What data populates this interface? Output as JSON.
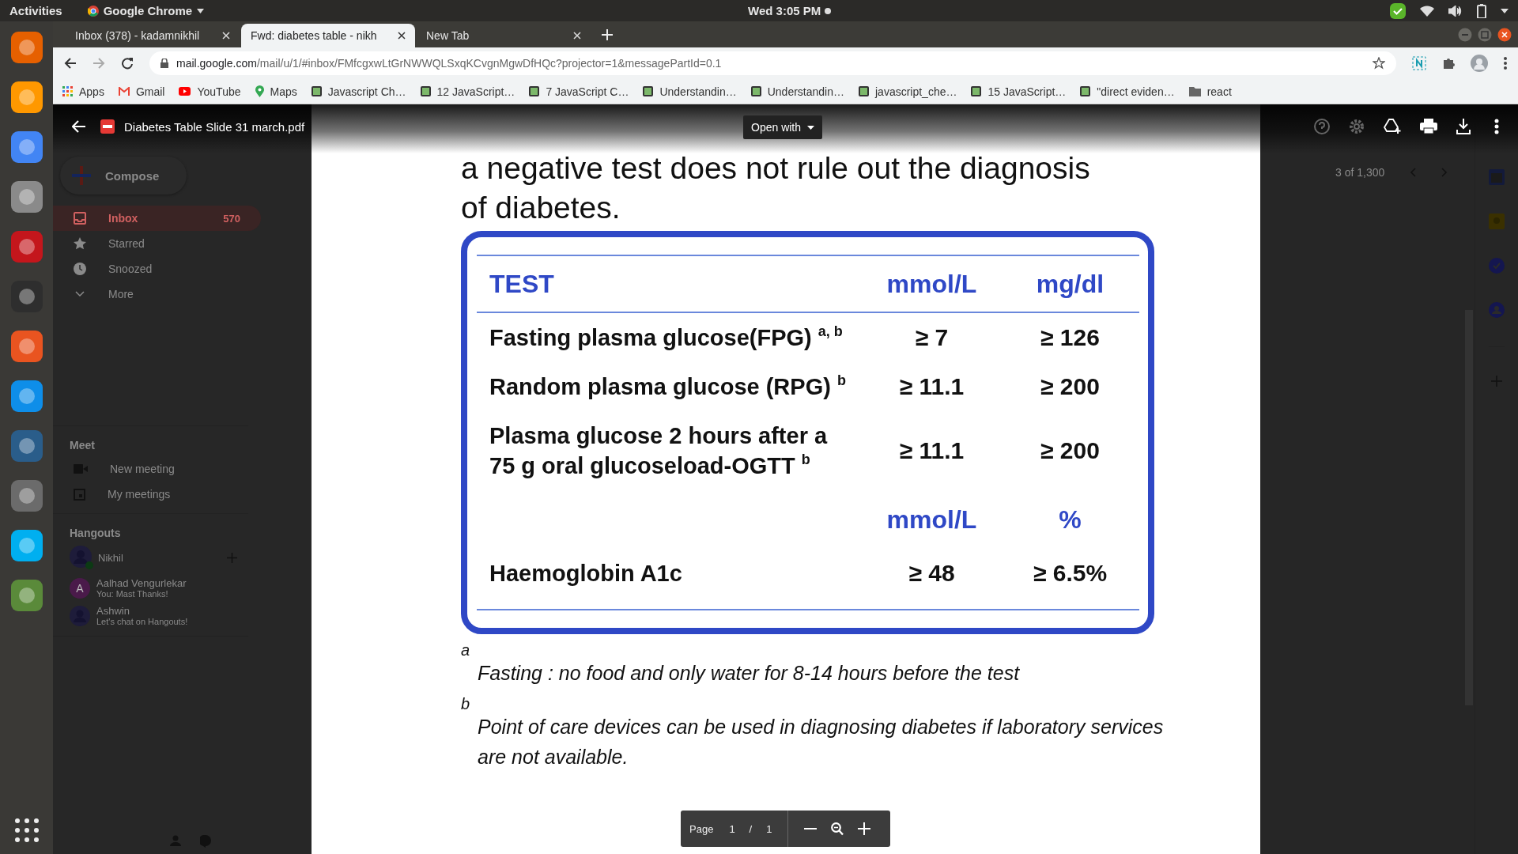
{
  "top_bar": {
    "activities": "Activities",
    "app": "Google Chrome",
    "clock": "Wed  3:05 PM"
  },
  "tabs": [
    {
      "title": "Inbox (378) - kadamnikhil",
      "selected": false
    },
    {
      "title": "Fwd: diabetes table - nikh",
      "selected": true
    },
    {
      "title": "New Tab",
      "selected": false
    }
  ],
  "address": {
    "host": "mail.google.com",
    "path": "/mail/u/1/#inbox/FMfcgxwLtGrNWWQLSxqKCvgnMgwDfHQc?projector=1&messagePartId=0.1"
  },
  "bookmarks": [
    {
      "kind": "apps",
      "label": "Apps"
    },
    {
      "kind": "gmail",
      "label": "Gmail"
    },
    {
      "kind": "youtube",
      "label": "YouTube"
    },
    {
      "kind": "maps",
      "label": "Maps"
    },
    {
      "kind": "site",
      "label": "Javascript Ch…"
    },
    {
      "kind": "site",
      "label": "12 JavaScript…"
    },
    {
      "kind": "site",
      "label": "7 JavaScript C…"
    },
    {
      "kind": "site",
      "label": "Understandin…"
    },
    {
      "kind": "site",
      "label": "Understandin…"
    },
    {
      "kind": "site",
      "label": "javascript_che…"
    },
    {
      "kind": "site",
      "label": "15 JavaScript…"
    },
    {
      "kind": "site",
      "label": "\"direct eviden…"
    },
    {
      "kind": "folder",
      "label": "react"
    }
  ],
  "gmail": {
    "compose": "Compose",
    "nav": [
      {
        "kind": "inbox",
        "label": "Inbox",
        "count": "570",
        "selected": true
      },
      {
        "kind": "star",
        "label": "Starred",
        "selected": false
      },
      {
        "kind": "clock",
        "label": "Snoozed",
        "selected": false
      },
      {
        "kind": "more",
        "label": "More",
        "selected": false
      }
    ],
    "meet": {
      "title": "Meet",
      "items": [
        {
          "kind": "video",
          "label": "New meeting"
        },
        {
          "kind": "calendar",
          "label": "My meetings"
        }
      ]
    },
    "hangouts": {
      "title": "Hangouts",
      "user": "Nikhil",
      "contacts": [
        {
          "kind": "letter",
          "initial": "A",
          "name": "Aalhad Vengurlekar",
          "message": "You: Mast Thanks!"
        },
        {
          "kind": "person",
          "name": "Ashwin",
          "message": "Let's chat on Hangouts!"
        }
      ]
    },
    "pager": "3 of 1,300"
  },
  "viewer": {
    "file_name": "Diabetes Table Slide 31 march.pdf",
    "open_with": "Open with"
  },
  "pdf": {
    "heading_lines": [
      "a negative test does not rule out the diagnosis",
      "of diabetes."
    ],
    "table": {
      "columns": [
        "TEST",
        "mmol/L",
        "mg/dl"
      ],
      "rows": [
        {
          "kind": "data",
          "test": "Fasting plasma glucose(FPG) $^{a, b}$",
          "mmol": "≥ 7",
          "mgdl": "≥ 126"
        },
        {
          "kind": "data",
          "test": "Random plasma glucose (RPG) $^{b}$",
          "mmol": "≥ 11.1",
          "mgdl": "≥ 200"
        },
        {
          "kind": "data",
          "test": "Plasma glucose 2 hours after a\n75 g oral glucoseload-OGTT $^{b}$",
          "mmol": "≥ 11.1",
          "mgdl": "≥ 200"
        },
        {
          "kind": "subheader",
          "mmol": "mmol/L",
          "mgdl": "%"
        },
        {
          "kind": "data",
          "test": "Haemoglobin A1c",
          "mmol": "≥ 48",
          "mgdl": "≥ 6.5%"
        }
      ]
    },
    "footnotes": [
      {
        "mark": "a",
        "text": "Fasting : no food and only water for 8-14 hours before the test"
      },
      {
        "mark": "b",
        "text": "Point of care devices can be used in diagnosing diabetes if laboratory services are not available."
      }
    ]
  },
  "page_toolbar": {
    "label": "Page",
    "current": "1",
    "separator": "/",
    "total": "1"
  }
}
